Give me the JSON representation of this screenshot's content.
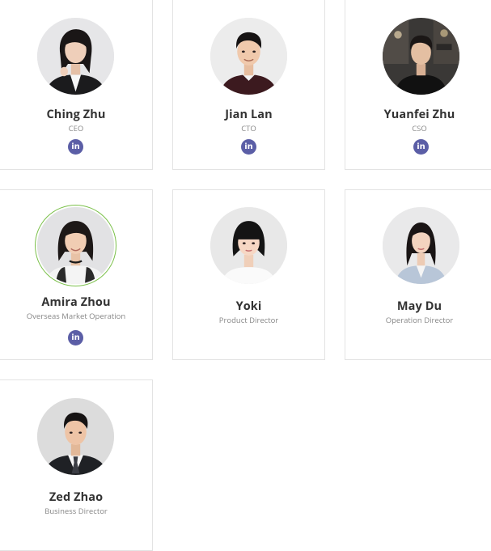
{
  "colors": {
    "card_border": "#e3e3e3",
    "name": "#333333",
    "role": "#888888",
    "linkedin_badge": "#5b5ea6",
    "avatar_ring": "#7bc04a"
  },
  "linkedin_glyph": "in",
  "team": [
    {
      "name": "Ching Zhu",
      "role": "CEO",
      "linkedin": true,
      "photo": "avatar-woman-black-blazer"
    },
    {
      "name": "Jian Lan",
      "role": "CTO",
      "linkedin": true,
      "photo": "avatar-man-maroon-sweater"
    },
    {
      "name": "Yuanfei Zhu",
      "role": "CSO",
      "linkedin": true,
      "photo": "avatar-man-black-tshirt"
    },
    {
      "name": "Amira Zhou",
      "role": "Overseas Market Operation",
      "linkedin": true,
      "photo": "avatar-woman-choker"
    },
    {
      "name": "Yoki",
      "role": "Product Director",
      "linkedin": false,
      "photo": "avatar-woman-bangs"
    },
    {
      "name": "May Du",
      "role": "Operation Director",
      "linkedin": false,
      "photo": "avatar-woman-denim"
    },
    {
      "name": "Zed Zhao",
      "role": "Business Director",
      "linkedin": false,
      "photo": "avatar-man-suit"
    }
  ]
}
